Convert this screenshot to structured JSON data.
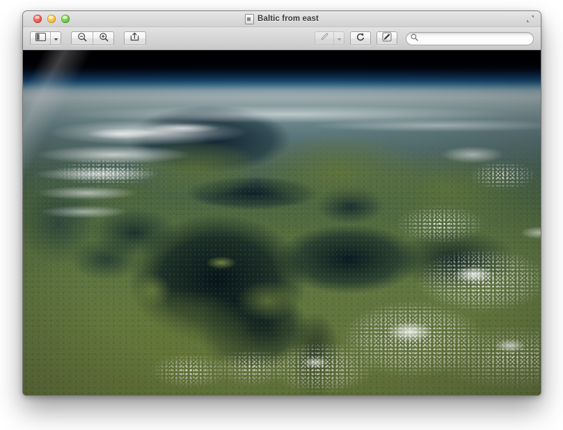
{
  "window": {
    "title": "Baltic from east",
    "doc_icon": "document-icon",
    "traffic_lights": [
      {
        "name": "close",
        "color": "#e8564a"
      },
      {
        "name": "minimize",
        "color": "#f2bb3e"
      },
      {
        "name": "zoom",
        "color": "#69c243"
      }
    ],
    "fullscreen_icon": "fullscreen-expand-icon"
  },
  "toolbar": {
    "sidebar_button": {
      "icon": "sidebar-toggle-icon",
      "menu_icon": "chevron-down-icon"
    },
    "zoom_out_button": {
      "icon": "zoom-out-icon"
    },
    "zoom_in_button": {
      "icon": "zoom-in-icon"
    },
    "share_button": {
      "icon": "share-icon"
    },
    "markup_button": {
      "icon": "pen-markup-icon",
      "menu_icon": "chevron-down-icon",
      "state": "disabled"
    },
    "rotate_button": {
      "icon": "rotate-left-icon"
    },
    "edit_button": {
      "icon": "edit-markup-icon"
    },
    "search": {
      "icon": "search-icon",
      "value": "",
      "placeholder": ""
    }
  },
  "image_content": {
    "description": "Satellite photograph of Earth from orbit showing the Baltic Sea region viewed from the east",
    "caption": "Baltic from east"
  }
}
